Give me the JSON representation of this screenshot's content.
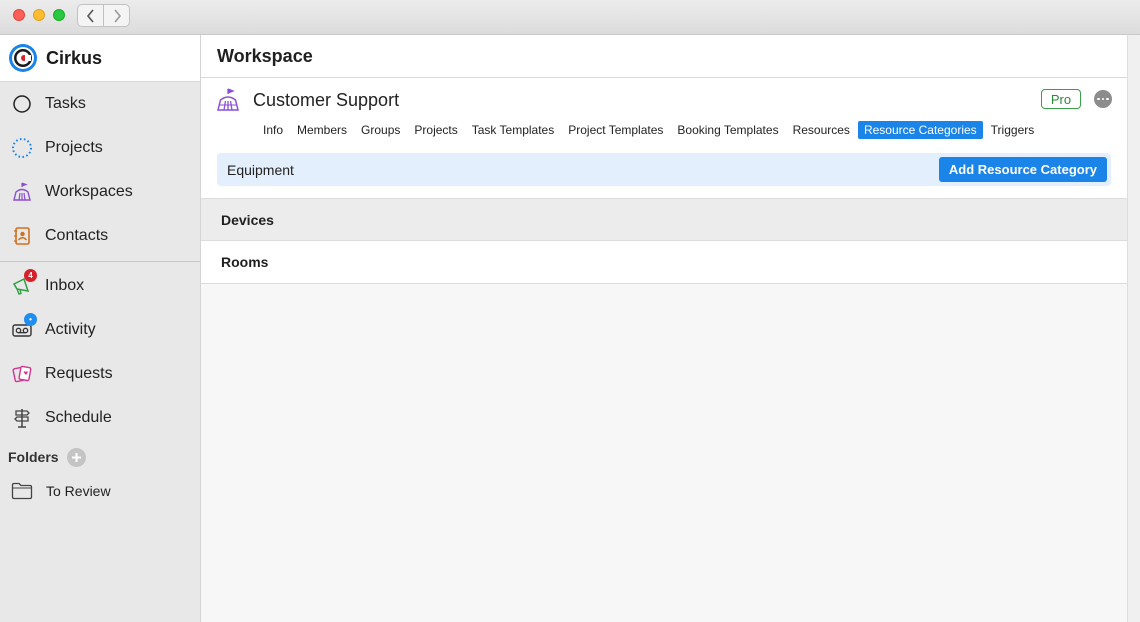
{
  "app": {
    "name": "Cirkus",
    "brand_color": "#1a84e8",
    "accent_red": "#d8202a"
  },
  "sidebar": {
    "items": [
      {
        "label": "Tasks",
        "icon": "circle-icon"
      },
      {
        "label": "Projects",
        "icon": "dotted-circle-icon"
      },
      {
        "label": "Workspaces",
        "icon": "tent-icon"
      },
      {
        "label": "Contacts",
        "icon": "contact-book-icon"
      },
      {
        "label": "Inbox",
        "icon": "megaphone-icon",
        "badge": "4"
      },
      {
        "label": "Activity",
        "icon": "voicemail-icon",
        "badge": "•"
      },
      {
        "label": "Requests",
        "icon": "cards-icon"
      },
      {
        "label": "Schedule",
        "icon": "signpost-icon"
      }
    ],
    "folders_heading": "Folders",
    "folders": [
      {
        "label": "To Review",
        "icon": "folder-icon"
      }
    ]
  },
  "main": {
    "section_title": "Workspace",
    "workspace_name": "Customer Support",
    "plan_badge": "Pro",
    "tabs": [
      "Info",
      "Members",
      "Groups",
      "Projects",
      "Task Templates",
      "Project Templates",
      "Booking Templates",
      "Resources",
      "Resource Categories",
      "Triggers"
    ],
    "active_tab": "Resource Categories",
    "category_bar": {
      "label": "Equipment",
      "button": "Add Resource Category"
    },
    "rows": [
      {
        "label": "Devices",
        "selected": true
      },
      {
        "label": "Rooms",
        "selected": false
      }
    ]
  }
}
